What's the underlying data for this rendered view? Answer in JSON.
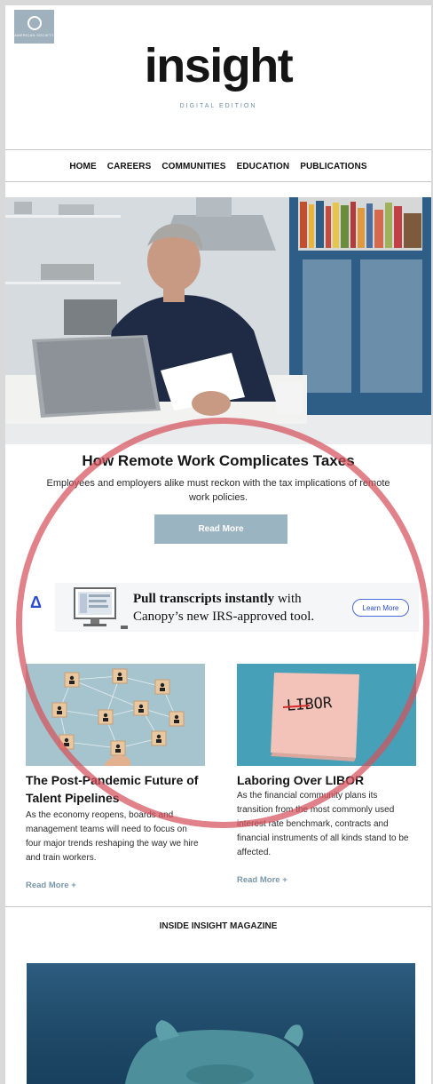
{
  "header": {
    "badge_text": "AMERICAN SOCIETY",
    "title": "insight",
    "subtitle": "DIGITAL EDITION"
  },
  "nav": {
    "items": [
      "HOME",
      "CAREERS",
      "COMMUNITIES",
      "EDUCATION",
      "PUBLICATIONS"
    ]
  },
  "feature": {
    "title": "How Remote Work Complicates Taxes",
    "description": "Employees and employers alike must reckon with the tax implications of remote work policies.",
    "button": "Read More"
  },
  "ad": {
    "logo": "Δ",
    "headline_bold": "Pull transcripts instantly",
    "headline_rest": " with",
    "line2": "Canopy’s new IRS-approved tool.",
    "button": "Learn More"
  },
  "cards": [
    {
      "title": "The Post-Pandemic Future of Talent Pipelines",
      "body": "As the economy reopens, boards and management teams will need to focus on four major trends reshaping the way we hire and train workers.",
      "link": "Read More +"
    },
    {
      "title": "Laboring Over LIBOR",
      "body": "As the financial community plans its transition from the most commonly used interest rate benchmark, contracts and financial instruments of all kinds stand to be affected.",
      "link": "Read More +",
      "image_text": "LIBOR"
    }
  ],
  "section": {
    "title": "INSIDE INSIGHT MAGAZINE"
  },
  "colors": {
    "accent": "#9bb4c2",
    "link": "#7896ab",
    "circle": "#d5525d",
    "ad_blue": "#2a4bd0",
    "cover": "#1e4866"
  }
}
